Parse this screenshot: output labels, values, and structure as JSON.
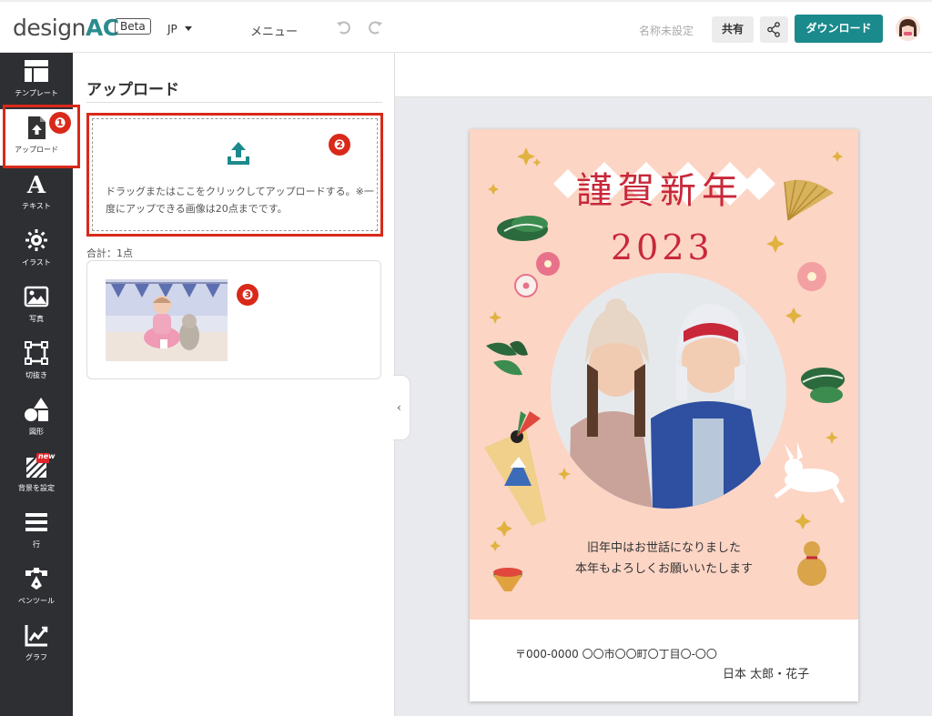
{
  "header": {
    "logo_text": "design",
    "logo_accent": "AC",
    "beta_label": "Beta",
    "language": "JP",
    "menu_label": "メニュー",
    "document_name": "名称未設定",
    "share_label": "共有",
    "download_label": "ダウンロード"
  },
  "sidebar": {
    "items": [
      {
        "label": "テンプレート",
        "icon": "template-icon"
      },
      {
        "label": "アップロード",
        "icon": "upload-file-icon"
      },
      {
        "label": "テキスト",
        "icon": "text-icon"
      },
      {
        "label": "イラスト",
        "icon": "illustration-icon"
      },
      {
        "label": "写真",
        "icon": "photo-icon"
      },
      {
        "label": "切抜き",
        "icon": "crop-icon"
      },
      {
        "label": "図形",
        "icon": "shapes-icon"
      },
      {
        "label": "背景を設定",
        "icon": "background-icon",
        "badge": "new"
      },
      {
        "label": "行",
        "icon": "lines-icon"
      },
      {
        "label": "ペンツール",
        "icon": "pen-tool-icon"
      },
      {
        "label": "グラフ",
        "icon": "chart-icon"
      }
    ]
  },
  "annotations": {
    "step1": "❶",
    "step2": "❷",
    "step3": "❸"
  },
  "upload_panel": {
    "title": "アップロード",
    "drop_text": "ドラッグまたはここをクリックしてアップロードする。※一度にアップできる画像は20点までです。",
    "count_label": "合計：1点"
  },
  "card": {
    "title": "謹賀新年",
    "year": "2023",
    "greeting_line1": "旧年中はお世話になりました",
    "greeting_line2": "本年もよろしくお願いいたします",
    "address": "〒000-0000 〇〇市〇〇町〇丁目〇-〇〇",
    "names": "日本 太郎・花子"
  },
  "colors": {
    "accent": "#1b8a8c",
    "highlight": "#d9291a",
    "sidebar_bg": "#2e2f33",
    "card_bg": "#fcd5c5",
    "card_title": "#c8283a"
  }
}
